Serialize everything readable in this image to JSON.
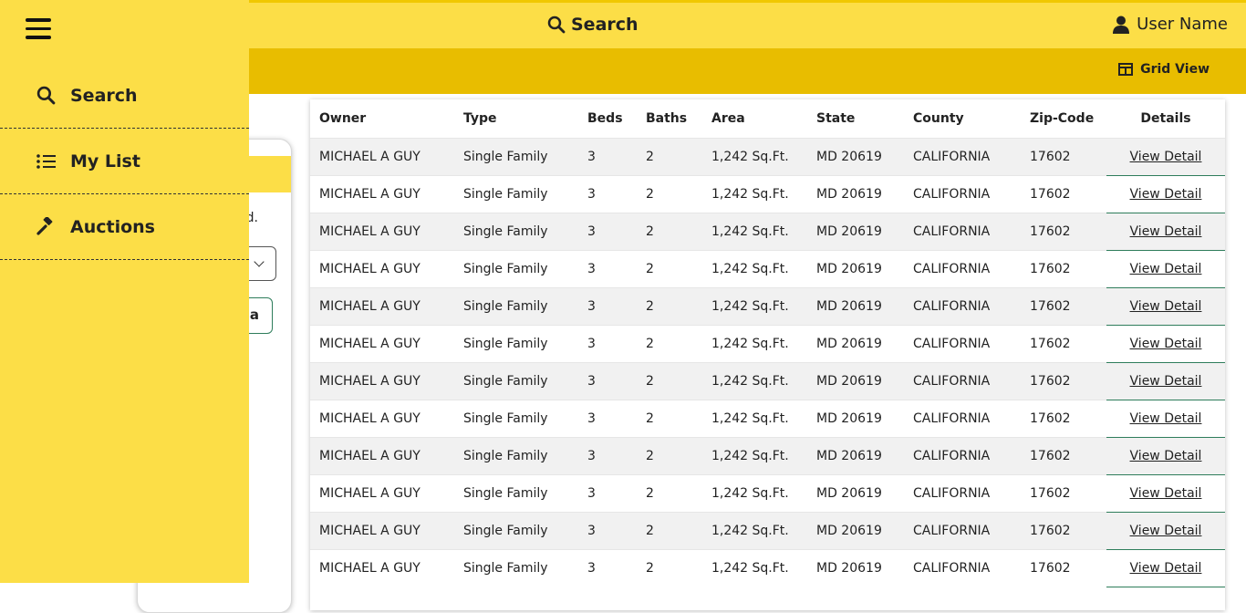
{
  "header": {
    "search_label": "Search",
    "user_label": "User Name"
  },
  "subbar": {
    "grid_view_label": "Grid View"
  },
  "sidebar": {
    "items": [
      {
        "label": "Search",
        "icon": "search-icon"
      },
      {
        "label": "My List",
        "icon": "list-icon"
      },
      {
        "label": "Auctions",
        "icon": "gavel-icon"
      }
    ]
  },
  "filter_card": {
    "note_text": "ed.",
    "button_text": "a"
  },
  "table": {
    "columns": [
      "Owner",
      "Type",
      "Beds",
      "Baths",
      "Area",
      "State",
      "County",
      "Zip-Code",
      "Details"
    ],
    "rows": [
      {
        "owner": "MICHAEL A GUY",
        "type": "Single Family",
        "beds": "3",
        "baths": "2",
        "area": "1,242 Sq.Ft.",
        "state": "MD 20619",
        "county": "CALIFORNIA",
        "zip": "17602",
        "details": "View Detail"
      },
      {
        "owner": "MICHAEL A GUY",
        "type": "Single Family",
        "beds": "3",
        "baths": "2",
        "area": "1,242 Sq.Ft.",
        "state": "MD 20619",
        "county": "CALIFORNIA",
        "zip": "17602",
        "details": "View Detail"
      },
      {
        "owner": "MICHAEL A GUY",
        "type": "Single Family",
        "beds": "3",
        "baths": "2",
        "area": "1,242 Sq.Ft.",
        "state": "MD 20619",
        "county": "CALIFORNIA",
        "zip": "17602",
        "details": "View Detail"
      },
      {
        "owner": "MICHAEL A GUY",
        "type": "Single Family",
        "beds": "3",
        "baths": "2",
        "area": "1,242 Sq.Ft.",
        "state": "MD 20619",
        "county": "CALIFORNIA",
        "zip": "17602",
        "details": "View Detail"
      },
      {
        "owner": "MICHAEL A GUY",
        "type": "Single Family",
        "beds": "3",
        "baths": "2",
        "area": "1,242 Sq.Ft.",
        "state": "MD 20619",
        "county": "CALIFORNIA",
        "zip": "17602",
        "details": "View Detail"
      },
      {
        "owner": "MICHAEL A GUY",
        "type": "Single Family",
        "beds": "3",
        "baths": "2",
        "area": "1,242 Sq.Ft.",
        "state": "MD 20619",
        "county": "CALIFORNIA",
        "zip": "17602",
        "details": "View Detail"
      },
      {
        "owner": "MICHAEL A GUY",
        "type": "Single Family",
        "beds": "3",
        "baths": "2",
        "area": "1,242 Sq.Ft.",
        "state": "MD 20619",
        "county": "CALIFORNIA",
        "zip": "17602",
        "details": "View Detail"
      },
      {
        "owner": "MICHAEL A GUY",
        "type": "Single Family",
        "beds": "3",
        "baths": "2",
        "area": "1,242 Sq.Ft.",
        "state": "MD 20619",
        "county": "CALIFORNIA",
        "zip": "17602",
        "details": "View Detail"
      },
      {
        "owner": "MICHAEL A GUY",
        "type": "Single Family",
        "beds": "3",
        "baths": "2",
        "area": "1,242 Sq.Ft.",
        "state": "MD 20619",
        "county": "CALIFORNIA",
        "zip": "17602",
        "details": "View Detail"
      },
      {
        "owner": "MICHAEL A GUY",
        "type": "Single Family",
        "beds": "3",
        "baths": "2",
        "area": "1,242 Sq.Ft.",
        "state": "MD 20619",
        "county": "CALIFORNIA",
        "zip": "17602",
        "details": "View Detail"
      },
      {
        "owner": "MICHAEL A GUY",
        "type": "Single Family",
        "beds": "3",
        "baths": "2",
        "area": "1,242 Sq.Ft.",
        "state": "MD 20619",
        "county": "CALIFORNIA",
        "zip": "17602",
        "details": "View Detail"
      },
      {
        "owner": "MICHAEL A GUY",
        "type": "Single Family",
        "beds": "3",
        "baths": "2",
        "area": "1,242 Sq.Ft.",
        "state": "MD 20619",
        "county": "CALIFORNIA",
        "zip": "17602",
        "details": "View Detail"
      }
    ]
  },
  "colors": {
    "header_yellow": "#fcde47",
    "subbar_gold": "#e8bd00",
    "accent_green": "#2e7d5b"
  }
}
